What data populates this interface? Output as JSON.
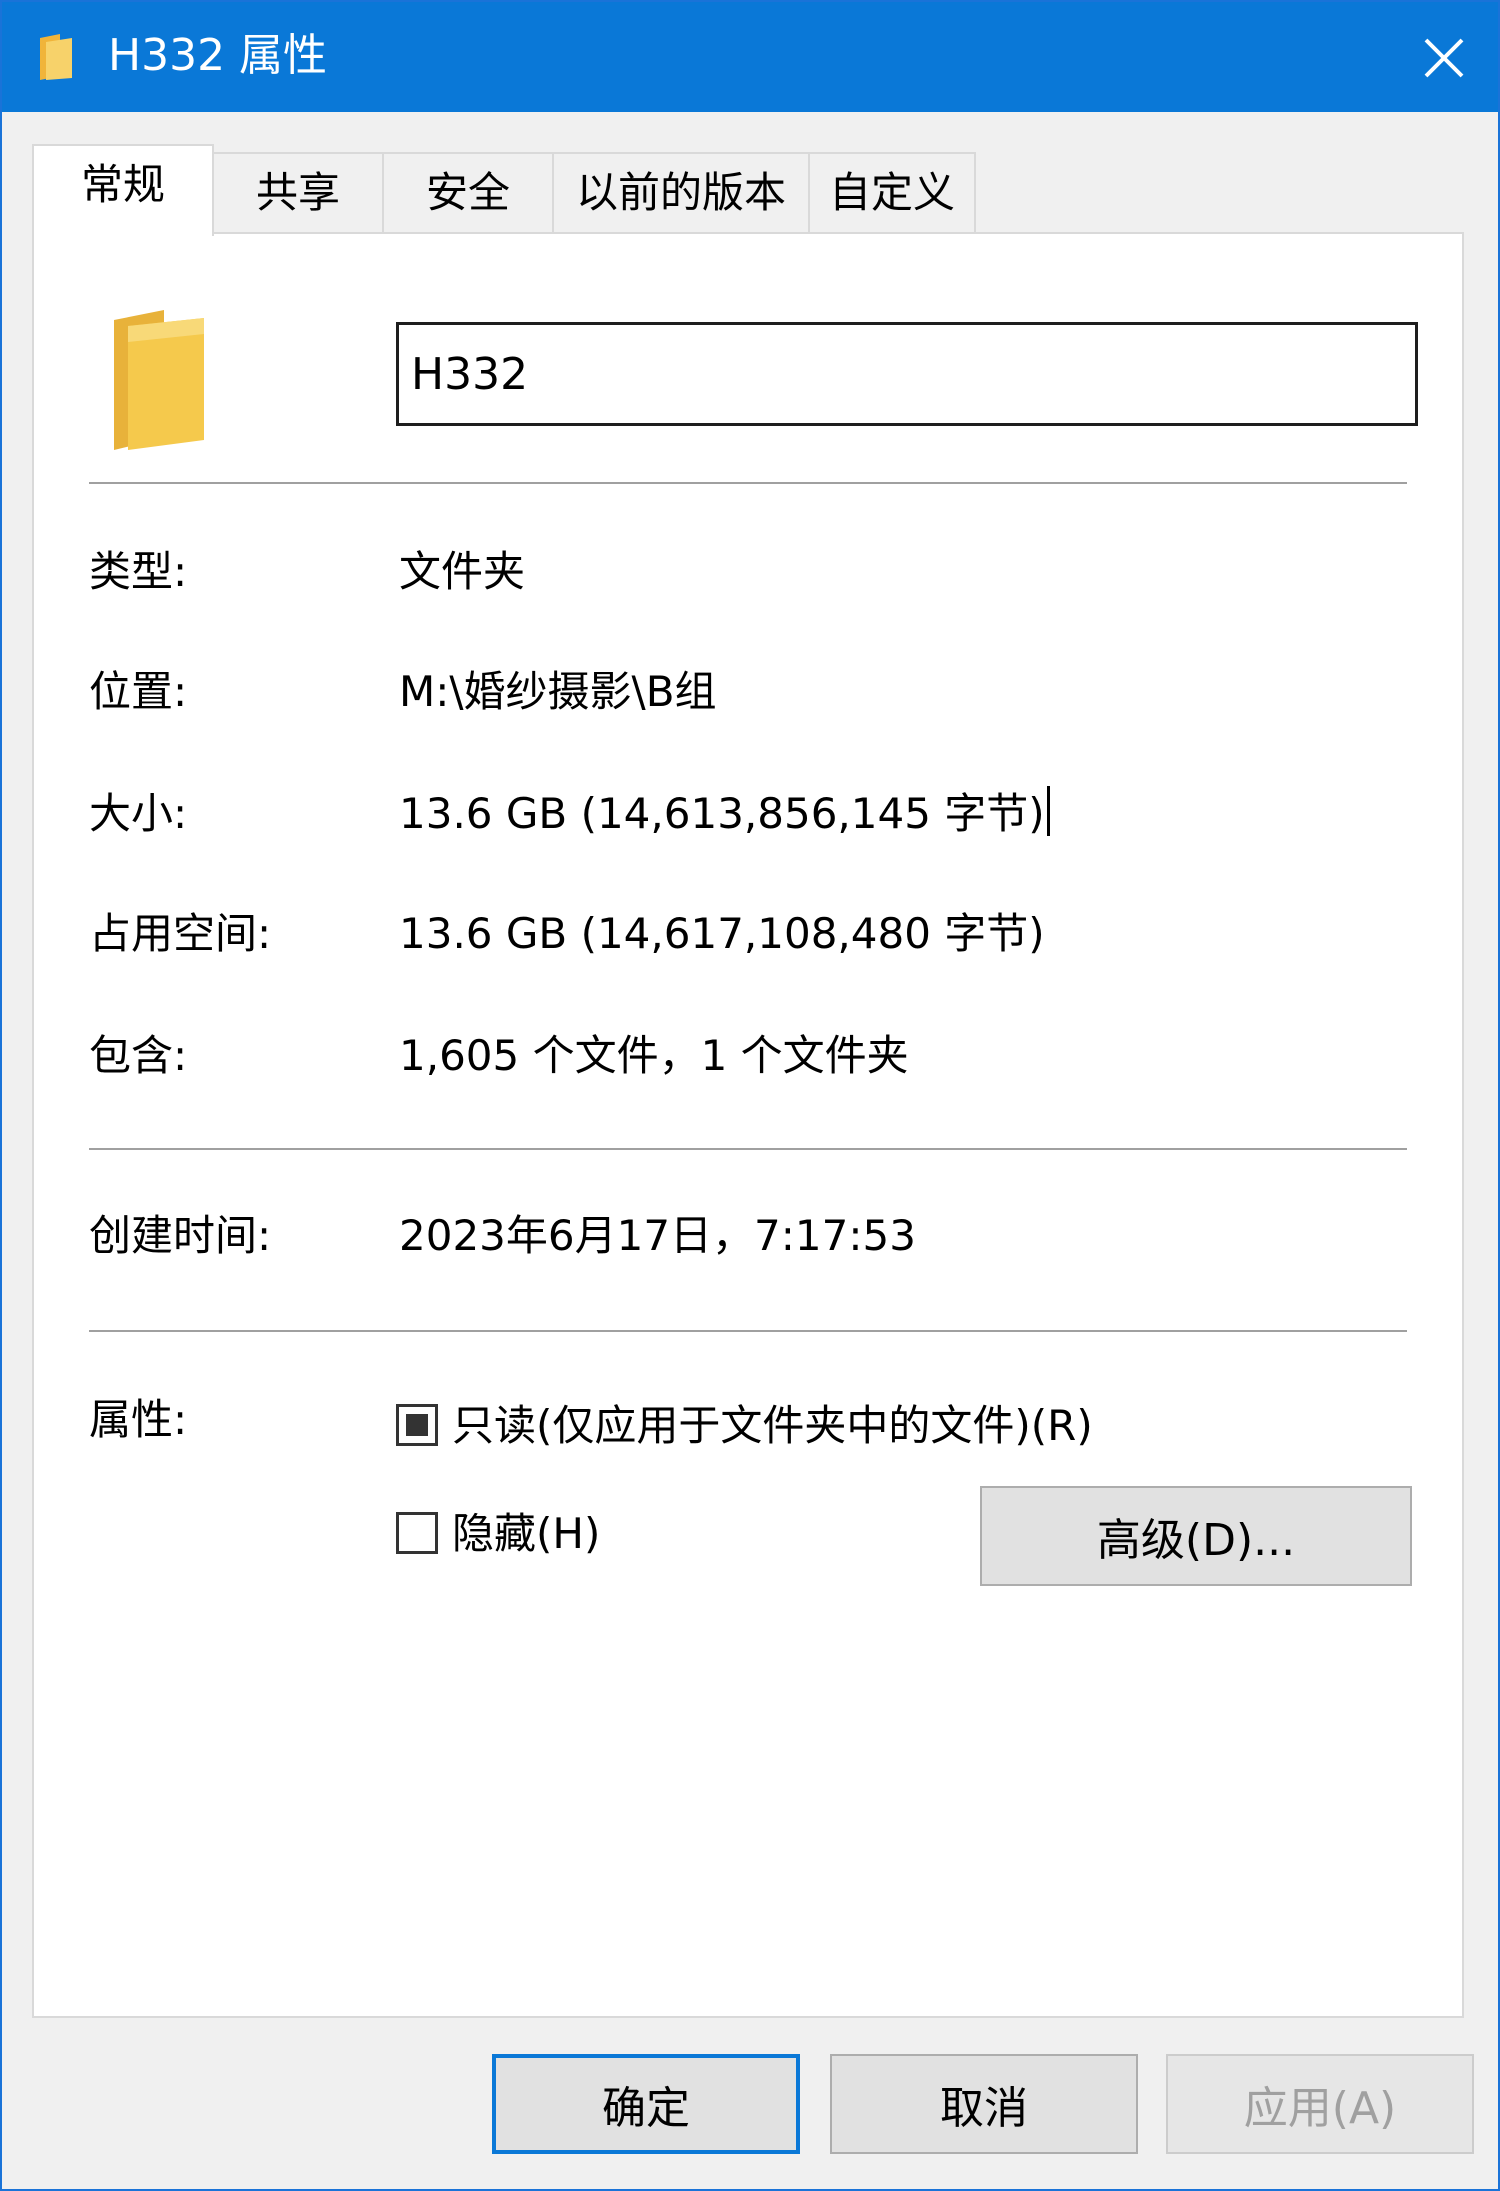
{
  "window": {
    "title": "H332 属性",
    "close_label": "✕"
  },
  "tabs": [
    {
      "label": "常规",
      "active": true
    },
    {
      "label": "共享",
      "active": false
    },
    {
      "label": "安全",
      "active": false
    },
    {
      "label": "以前的版本",
      "active": false
    },
    {
      "label": "自定义",
      "active": false
    }
  ],
  "general": {
    "folder_name": "H332",
    "rows": {
      "type": {
        "label": "类型:",
        "value": "文件夹"
      },
      "location": {
        "label": "位置:",
        "value": "M:\\婚纱摄影\\B组"
      },
      "size": {
        "label": "大小:",
        "value": "13.6 GB (14,613,856,145 字节)"
      },
      "size_on_disk": {
        "label": "占用空间:",
        "value": "13.6 GB (14,617,108,480 字节)"
      },
      "contains": {
        "label": "包含:",
        "value": "1,605 个文件，1 个文件夹"
      },
      "created": {
        "label": "创建时间:",
        "value": "2023年6月17日，7:17:53"
      }
    },
    "attributes": {
      "label": "属性:",
      "readonly": {
        "label": "只读(仅应用于文件夹中的文件)(R)",
        "state": "indeterminate"
      },
      "hidden": {
        "label": "隐藏(H)",
        "state": "unchecked"
      },
      "advanced_button": "高级(D)..."
    }
  },
  "footer": {
    "ok": "确定",
    "cancel": "取消",
    "apply": "应用(A)"
  },
  "colors": {
    "titlebar": "#0a78d7",
    "folder": "#f5c94c"
  },
  "icons": {
    "title": "folder-icon",
    "main": "folder-icon",
    "close": "close-icon"
  }
}
